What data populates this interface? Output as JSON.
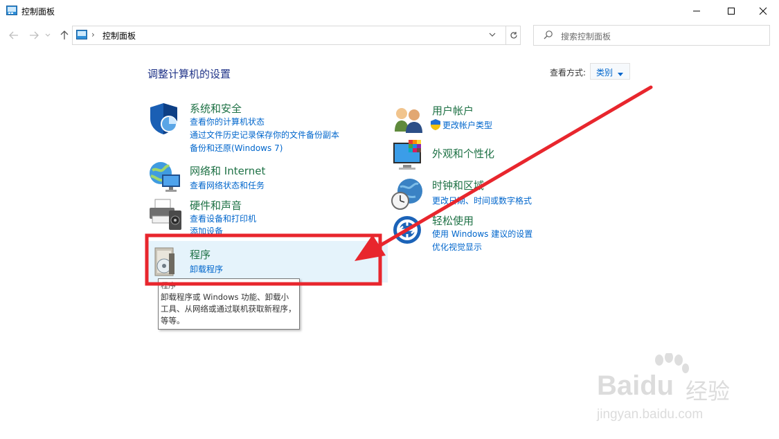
{
  "window": {
    "title": "控制面板",
    "minimize_glyph": "—",
    "maximize_glyph": "☐",
    "close_glyph": "✕"
  },
  "address": {
    "breadcrumb": "控制面板",
    "separator": "›"
  },
  "search": {
    "placeholder": "搜索控制面板"
  },
  "main": {
    "heading": "调整计算机的设置",
    "view_by_label": "查看方式:",
    "view_by_value": "类别"
  },
  "categories_left": [
    {
      "title": "系统和安全",
      "icon": "shield-icon",
      "links": [
        "查看你的计算机状态",
        "通过文件历史记录保存你的文件备份副本",
        "备份和还原(Windows 7)"
      ]
    },
    {
      "title": "网络和 Internet",
      "icon": "network-globe-icon",
      "links": [
        "查看网络状态和任务"
      ]
    },
    {
      "title": "硬件和声音",
      "icon": "printer-icon",
      "links": [
        "查看设备和打印机",
        "添加设备"
      ]
    },
    {
      "title": "程序",
      "icon": "programs-disc-icon",
      "links": [
        "卸载程序"
      ]
    }
  ],
  "categories_right": [
    {
      "title": "用户帐户",
      "icon": "users-icon",
      "links": [
        "更改帐户类型"
      ]
    },
    {
      "title": "外观和个性化",
      "icon": "monitor-palette-icon",
      "links": []
    },
    {
      "title": "时钟和区域",
      "icon": "clock-globe-icon",
      "links": [
        "更改日期、时间或数字格式"
      ]
    },
    {
      "title": "轻松使用",
      "icon": "ease-of-access-icon",
      "links": [
        "使用 Windows 建议的设置",
        "优化视觉显示"
      ]
    }
  ],
  "tooltip": {
    "title": "程序",
    "text": "卸载程序或 Windows 功能、卸载小工具、从网络或通过联机获取新程序，等等。"
  },
  "watermark": {
    "brand": "Baidu",
    "cn": "经验",
    "url": "jingyan.baidu.com"
  },
  "colors": {
    "category_green": "#1e7145",
    "link_blue": "#0066cc",
    "highlight_bg": "#e5f3fb",
    "annotation_red": "#e8262d"
  }
}
